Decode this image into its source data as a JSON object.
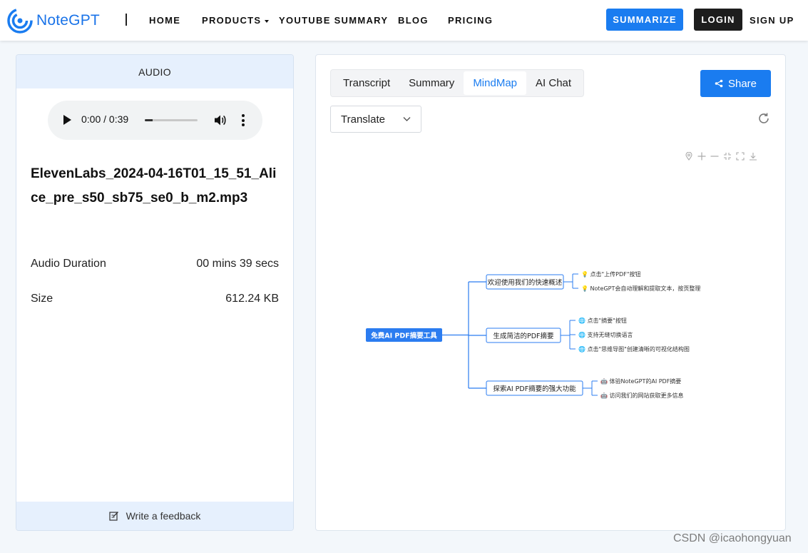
{
  "nav": {
    "logo_text": "NoteGPT",
    "links": [
      "HOME",
      "PRODUCTS",
      "YOUTUBE SUMMARY",
      "BLOG",
      "PRICING"
    ],
    "summarize": "SUMMARIZE",
    "login": "LOGIN",
    "signup": "SIGN UP",
    "brand_color": "#1a7cf0"
  },
  "left": {
    "header": "AUDIO",
    "player": {
      "time": "0:00 / 0:39",
      "progress": 0.15
    },
    "filename": "ElevenLabs_2024-04-16T01_15_51_Alice_pre_s50_sb75_se0_b_m2.mp3",
    "duration_label": "Audio Duration",
    "duration_value": "00 mins 39 secs",
    "size_label": "Size",
    "size_value": "612.24 KB",
    "feedback": "Write a feedback"
  },
  "right": {
    "tabs": [
      "Transcript",
      "Summary",
      "MindMap",
      "AI Chat"
    ],
    "active_tab": "MindMap",
    "share": "Share",
    "translate": "Translate",
    "tool_icons": [
      "pin-icon",
      "zoom-in-icon",
      "zoom-out-icon",
      "fit-icon",
      "fullscreen-icon",
      "download-icon"
    ]
  },
  "mindmap": {
    "root": "免费AI PDF摘要工具",
    "branches": [
      {
        "label": "欢迎使用我们的快速概述",
        "icon": "💡",
        "children": [
          "点击\"上传PDF\"按钮",
          "NoteGPT会自动理解和提取文本，按页整理"
        ]
      },
      {
        "label": "生成简洁的PDF摘要",
        "icon": "🌐",
        "children": [
          "点击\"摘要\"按钮",
          "支持无缝切换语言",
          "点击\"思维导图\"创建清晰的可视化结构图"
        ]
      },
      {
        "label": "探索AI PDF摘要的强大功能",
        "icon": "🤖",
        "children": [
          "体验NoteGPT的AI PDF摘要",
          "访问我们的网站获取更多信息"
        ]
      }
    ]
  },
  "watermark": "CSDN @icaohongyuan"
}
